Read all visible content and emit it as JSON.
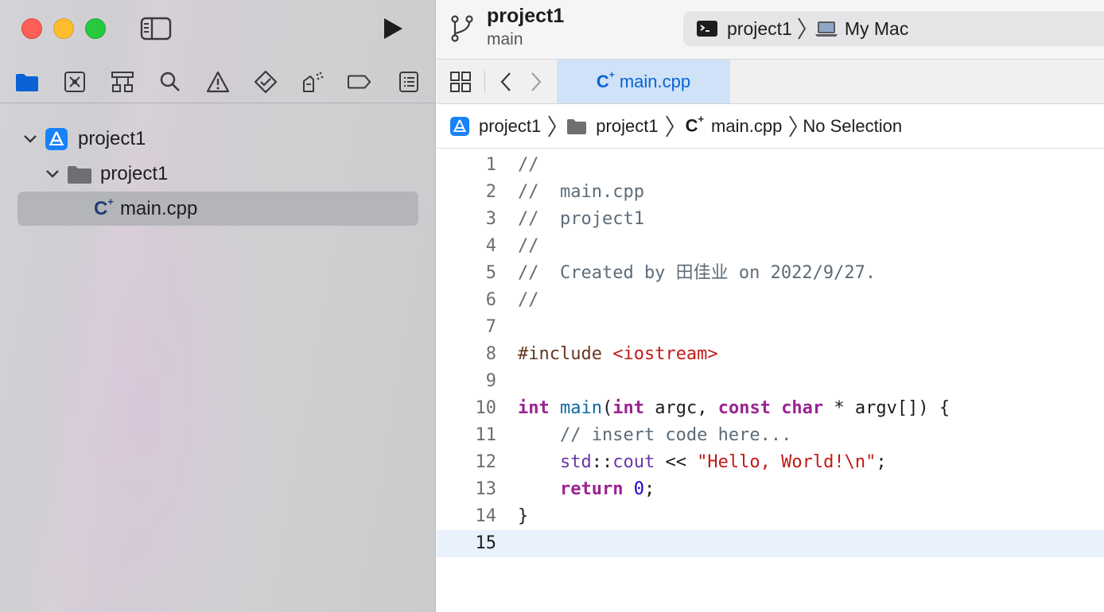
{
  "window": {
    "project_title": "project1",
    "branch": "main",
    "scheme": "project1",
    "destination": "My Mac"
  },
  "navigator": {
    "icons": [
      "folder-icon",
      "source-control-icon",
      "symbol-icon",
      "search-icon",
      "warning-icon",
      "test-icon",
      "debug-icon",
      "breakpoint-icon",
      "report-icon"
    ],
    "tree": [
      {
        "label": "project1",
        "type": "project"
      },
      {
        "label": "project1",
        "type": "folder"
      },
      {
        "label": "main.cpp",
        "type": "file",
        "selected": true
      }
    ],
    "cpp_glyph": "C",
    "cpp_plus": "+"
  },
  "tabs": [
    {
      "label": "main.cpp",
      "active": true
    }
  ],
  "jumpbar": {
    "items": [
      "project1",
      "project1",
      "main.cpp",
      "No Selection"
    ]
  },
  "editor": {
    "current_line": 15,
    "lines": [
      {
        "n": "1",
        "tokens": [
          {
            "t": "//",
            "c": "c-com"
          }
        ]
      },
      {
        "n": "2",
        "tokens": [
          {
            "t": "//  main.cpp",
            "c": "c-com"
          }
        ]
      },
      {
        "n": "3",
        "tokens": [
          {
            "t": "//  project1",
            "c": "c-com"
          }
        ]
      },
      {
        "n": "4",
        "tokens": [
          {
            "t": "//",
            "c": "c-com"
          }
        ]
      },
      {
        "n": "5",
        "tokens": [
          {
            "t": "//  Created by 田佳业 on 2022/9/27.",
            "c": "c-com"
          }
        ]
      },
      {
        "n": "6",
        "tokens": [
          {
            "t": "//",
            "c": "c-com"
          }
        ]
      },
      {
        "n": "7",
        "tokens": []
      },
      {
        "n": "8",
        "tokens": [
          {
            "t": "#include ",
            "c": "c-pp"
          },
          {
            "t": "<iostream>",
            "c": "c-str"
          }
        ]
      },
      {
        "n": "9",
        "tokens": []
      },
      {
        "n": "10",
        "tokens": [
          {
            "t": "int",
            "c": "c-kw"
          },
          {
            "t": " ",
            "c": "c-pl"
          },
          {
            "t": "main",
            "c": "c-fn"
          },
          {
            "t": "(",
            "c": "c-pl"
          },
          {
            "t": "int",
            "c": "c-kw"
          },
          {
            "t": " argc, ",
            "c": "c-pl"
          },
          {
            "t": "const",
            "c": "c-kw"
          },
          {
            "t": " ",
            "c": "c-pl"
          },
          {
            "t": "char",
            "c": "c-kw"
          },
          {
            "t": " * argv[]) {",
            "c": "c-pl"
          }
        ]
      },
      {
        "n": "11",
        "tokens": [
          {
            "t": "    // insert code here...",
            "c": "c-com"
          }
        ]
      },
      {
        "n": "12",
        "tokens": [
          {
            "t": "    std",
            "c": "c-cls"
          },
          {
            "t": "::",
            "c": "c-pl"
          },
          {
            "t": "cout",
            "c": "c-cls"
          },
          {
            "t": " << ",
            "c": "c-pl"
          },
          {
            "t": "\"Hello, World!\\n\"",
            "c": "c-str"
          },
          {
            "t": ";",
            "c": "c-pl"
          }
        ]
      },
      {
        "n": "13",
        "tokens": [
          {
            "t": "    ",
            "c": "c-pl"
          },
          {
            "t": "return",
            "c": "c-kw"
          },
          {
            "t": " ",
            "c": "c-pl"
          },
          {
            "t": "0",
            "c": "c-num"
          },
          {
            "t": ";",
            "c": "c-pl"
          }
        ]
      },
      {
        "n": "14",
        "tokens": [
          {
            "t": "}",
            "c": "c-pl"
          }
        ]
      },
      {
        "n": "15",
        "tokens": []
      }
    ]
  },
  "colors": {
    "accent": "#0a63d6",
    "close": "#fe5f57",
    "minimize": "#febc2e",
    "zoom": "#28c840",
    "app_icon": "#1a82f7"
  }
}
